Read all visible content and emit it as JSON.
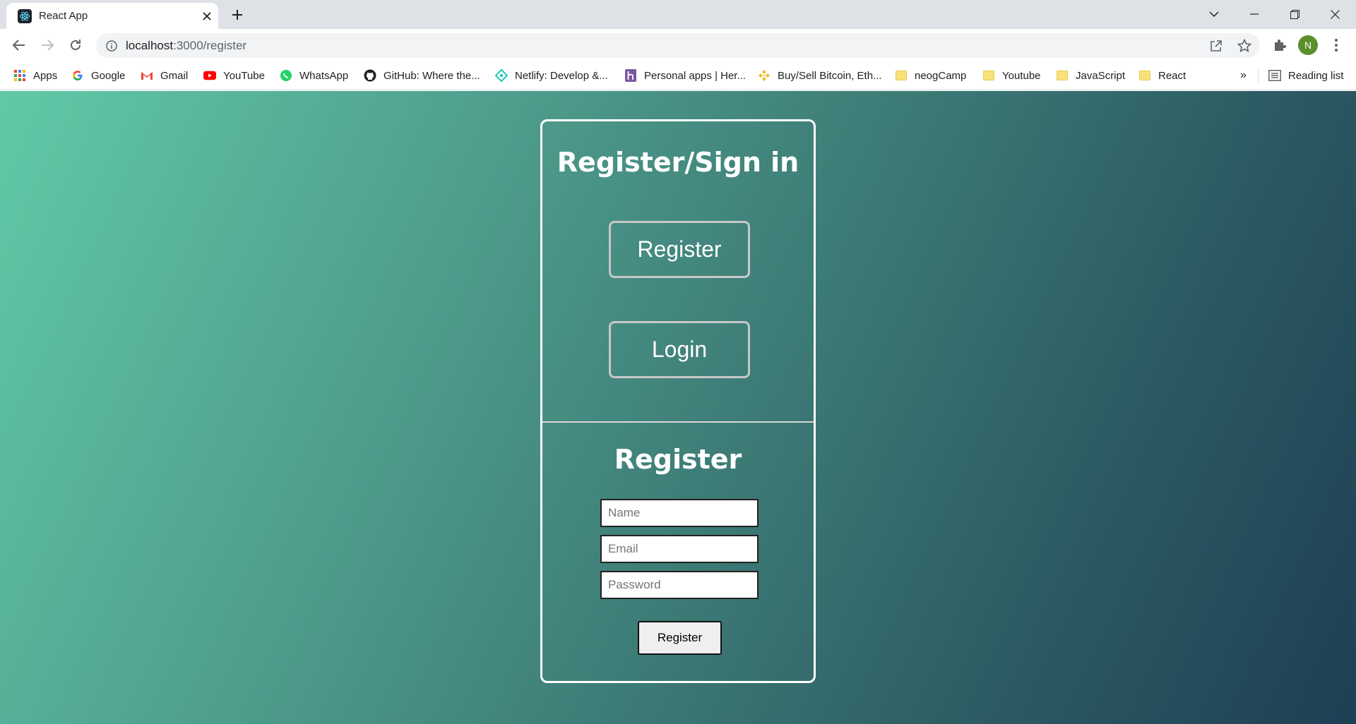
{
  "browser": {
    "tab": {
      "title": "React App",
      "favicon": "react-atom-icon"
    },
    "url": {
      "host": "localhost",
      "path": ":3000/register"
    },
    "profile_initial": "N",
    "colors": {
      "tabstrip": "#dee1e6",
      "avatar": "#5a8f29"
    }
  },
  "bookmarks": {
    "items": [
      {
        "label": "Apps",
        "icon": "apps-grid-icon"
      },
      {
        "label": "Google",
        "icon": "google-icon"
      },
      {
        "label": "Gmail",
        "icon": "gmail-icon"
      },
      {
        "label": "YouTube",
        "icon": "youtube-icon"
      },
      {
        "label": "WhatsApp",
        "icon": "whatsapp-icon"
      },
      {
        "label": "GitHub: Where the...",
        "icon": "github-icon"
      },
      {
        "label": "Netlify: Develop &...",
        "icon": "netlify-icon"
      },
      {
        "label": "Personal apps | Her...",
        "icon": "heroku-icon"
      },
      {
        "label": "Buy/Sell Bitcoin, Eth...",
        "icon": "binance-icon"
      },
      {
        "label": "neogCamp",
        "icon": "folder-icon"
      },
      {
        "label": "Youtube",
        "icon": "folder-icon"
      },
      {
        "label": "JavaScript",
        "icon": "folder-icon"
      },
      {
        "label": "React",
        "icon": "folder-icon"
      }
    ],
    "overflow": "»",
    "reading_list": "Reading list"
  },
  "page": {
    "colors": {
      "gradient_start": "#61c9a7",
      "gradient_end": "#1e3f54",
      "card_border": "#ffffff"
    },
    "heading": "Register/Sign in",
    "register_button": "Register",
    "login_button": "Login",
    "form": {
      "title": "Register",
      "name_placeholder": "Name",
      "email_placeholder": "Email",
      "password_placeholder": "Password",
      "submit_label": "Register"
    }
  }
}
